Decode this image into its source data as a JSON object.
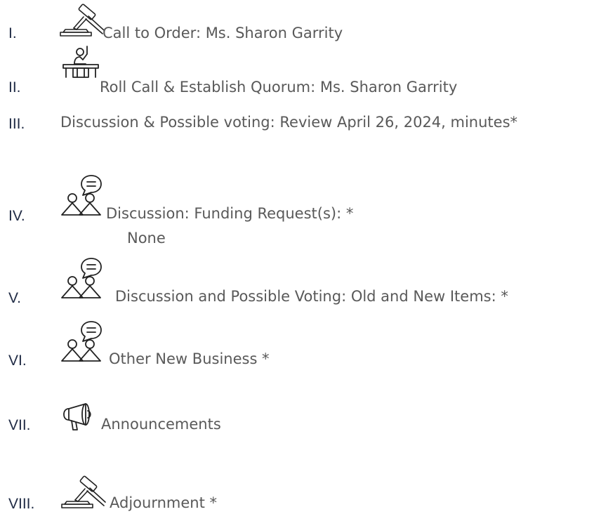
{
  "agenda": {
    "items": [
      {
        "numeral": "I.",
        "icon": "gavel-icon",
        "text": "Call to Order: Ms. Sharon Garrity"
      },
      {
        "numeral": "II.",
        "icon": "podium-speaker-icon",
        "text": "Roll Call & Establish Quorum: Ms. Sharon Garrity"
      },
      {
        "numeral": "III.",
        "icon": "",
        "text": "Discussion & Possible voting: Review April 26, 2024, minutes*"
      },
      {
        "numeral": "IV.",
        "icon": "discussion-icon",
        "text": "Discussion: Funding Request(s): *",
        "subtext": "None"
      },
      {
        "numeral": "V.",
        "icon": "discussion-icon",
        "text": "Discussion and Possible Voting: Old and New Items: *"
      },
      {
        "numeral": "VI.",
        "icon": "discussion-icon",
        "text": "Other New Business *"
      },
      {
        "numeral": "VII.",
        "icon": "megaphone-icon",
        "text": "Announcements"
      },
      {
        "numeral": "VIII.",
        "icon": "gavel-icon",
        "text": "Adjournment *"
      }
    ]
  },
  "colors": {
    "numeral": "#1f2a44",
    "text": "#595959",
    "icon_stroke": "#222222"
  }
}
